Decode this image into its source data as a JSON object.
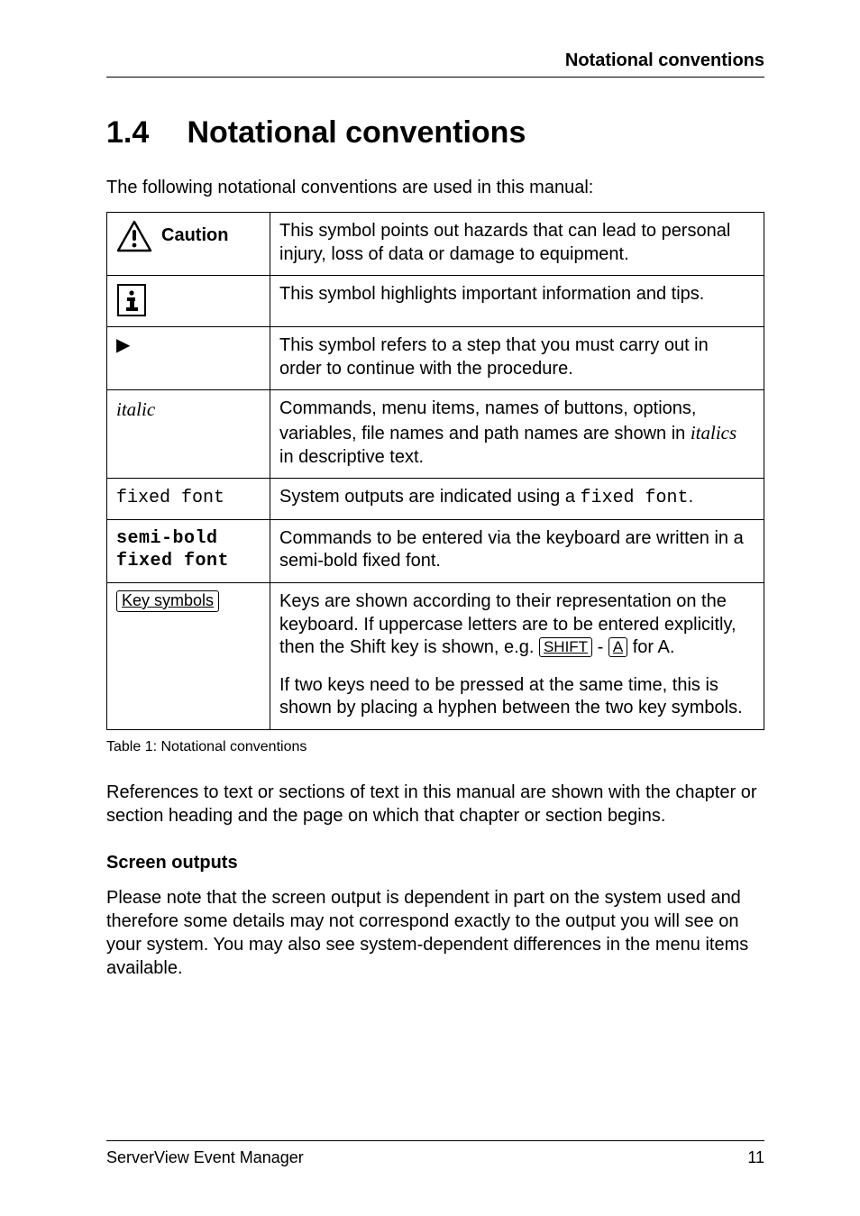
{
  "running_head": "Notational conventions",
  "heading": {
    "number": "1.4",
    "title": "Notational conventions"
  },
  "intro": "The following notational conventions are used in this manual:",
  "table": {
    "rows": {
      "caution": {
        "label": "Caution",
        "desc": "This symbol points out hazards that can lead to personal injury, loss of data or damage to equipment."
      },
      "info": {
        "desc": "This symbol highlights important information and tips."
      },
      "step": {
        "desc": "This symbol refers to a step that you must carry out in order to continue with the procedure."
      },
      "italic": {
        "label": "italic",
        "desc_pre": "Commands, menu items, names of buttons, options, variables, file names and path names are shown in ",
        "desc_em": "italics",
        "desc_post": " in descriptive text."
      },
      "fixed": {
        "label": "fixed font",
        "desc_pre": "System outputs are indicated using a ",
        "desc_code": "fixed font",
        "desc_post": "."
      },
      "semi": {
        "label_line1": "semi-bold",
        "label_line2": "fixed font",
        "desc": "Commands to be entered via the keyboard are written in a semi-bold fixed font."
      },
      "keys": {
        "label": "Key symbols",
        "desc_p1_pre": "Keys are shown according to their representation on the keyboard. If uppercase letters are to be entered explicitly, then the Shift key is shown, e.g. ",
        "desc_p1_k1": "SHIFT",
        "desc_p1_mid": " - ",
        "desc_p1_k2": "A",
        "desc_p1_post": " for A.",
        "desc_p2": "If two keys need to be pressed at the same time, this is shown by placing a hyphen between the two key symbols."
      }
    },
    "caption": "Table 1: Notational conventions"
  },
  "refs_para": "References to text or sections of text in this manual are shown with the chapter or section heading and the page on which that chapter or section begins.",
  "screen_outputs": {
    "heading": "Screen outputs",
    "body": "Please note that the screen output is dependent in part on the system used and therefore some details may not correspond exactly to the output you will see on your system. You may also see system-dependent differences in the menu items available."
  },
  "footer": {
    "left": "ServerView Event Manager",
    "right": "11"
  }
}
